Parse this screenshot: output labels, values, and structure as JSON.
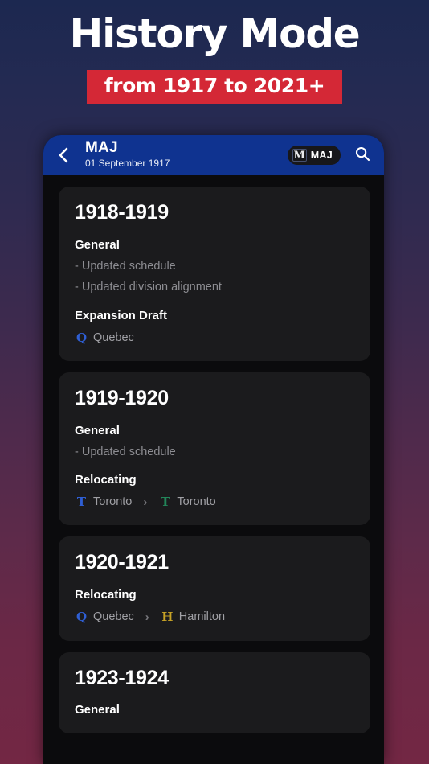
{
  "promo": {
    "title": "History Mode",
    "banner": "from 1917 to 2021+",
    "banner_color": "#d42836",
    "bg_top_color": "#1c2850",
    "bg_bottom_color": "#732744"
  },
  "appbar": {
    "back_icon": "chevron-left-icon",
    "title": "MAJ",
    "subtitle": "01 September 1917",
    "team_pill": {
      "logo_letter": "M",
      "label": "MAJ"
    },
    "search_icon": "search-icon",
    "bar_color": "#0f3390"
  },
  "cards": [
    {
      "season": "1918-1919",
      "sections": [
        {
          "title": "General",
          "bullets": [
            "- Updated schedule",
            "- Updated division alignment"
          ]
        },
        {
          "title": "Expansion Draft",
          "teams": [
            {
              "logo_letter": "Q",
              "logo_color": "#2f5fd4",
              "name": "Quebec"
            }
          ]
        }
      ]
    },
    {
      "season": "1919-1920",
      "sections": [
        {
          "title": "General",
          "bullets": [
            "- Updated schedule"
          ]
        },
        {
          "title": "Relocating",
          "teams": [
            {
              "logo_letter": "T",
              "logo_color": "#2f5fd4",
              "name": "Toronto"
            },
            {
              "logo_letter": "T",
              "logo_color": "#22865a",
              "name": "Toronto"
            }
          ],
          "separator": "›"
        }
      ]
    },
    {
      "season": "1920-1921",
      "sections": [
        {
          "title": "Relocating",
          "teams": [
            {
              "logo_letter": "Q",
              "logo_color": "#2f5fd4",
              "name": "Quebec"
            },
            {
              "logo_letter": "H",
              "logo_color": "#c8a326",
              "name": "Hamilton"
            }
          ],
          "separator": "›"
        }
      ]
    },
    {
      "season": "1923-1924",
      "sections": [
        {
          "title": "General",
          "bullets": []
        }
      ]
    }
  ]
}
